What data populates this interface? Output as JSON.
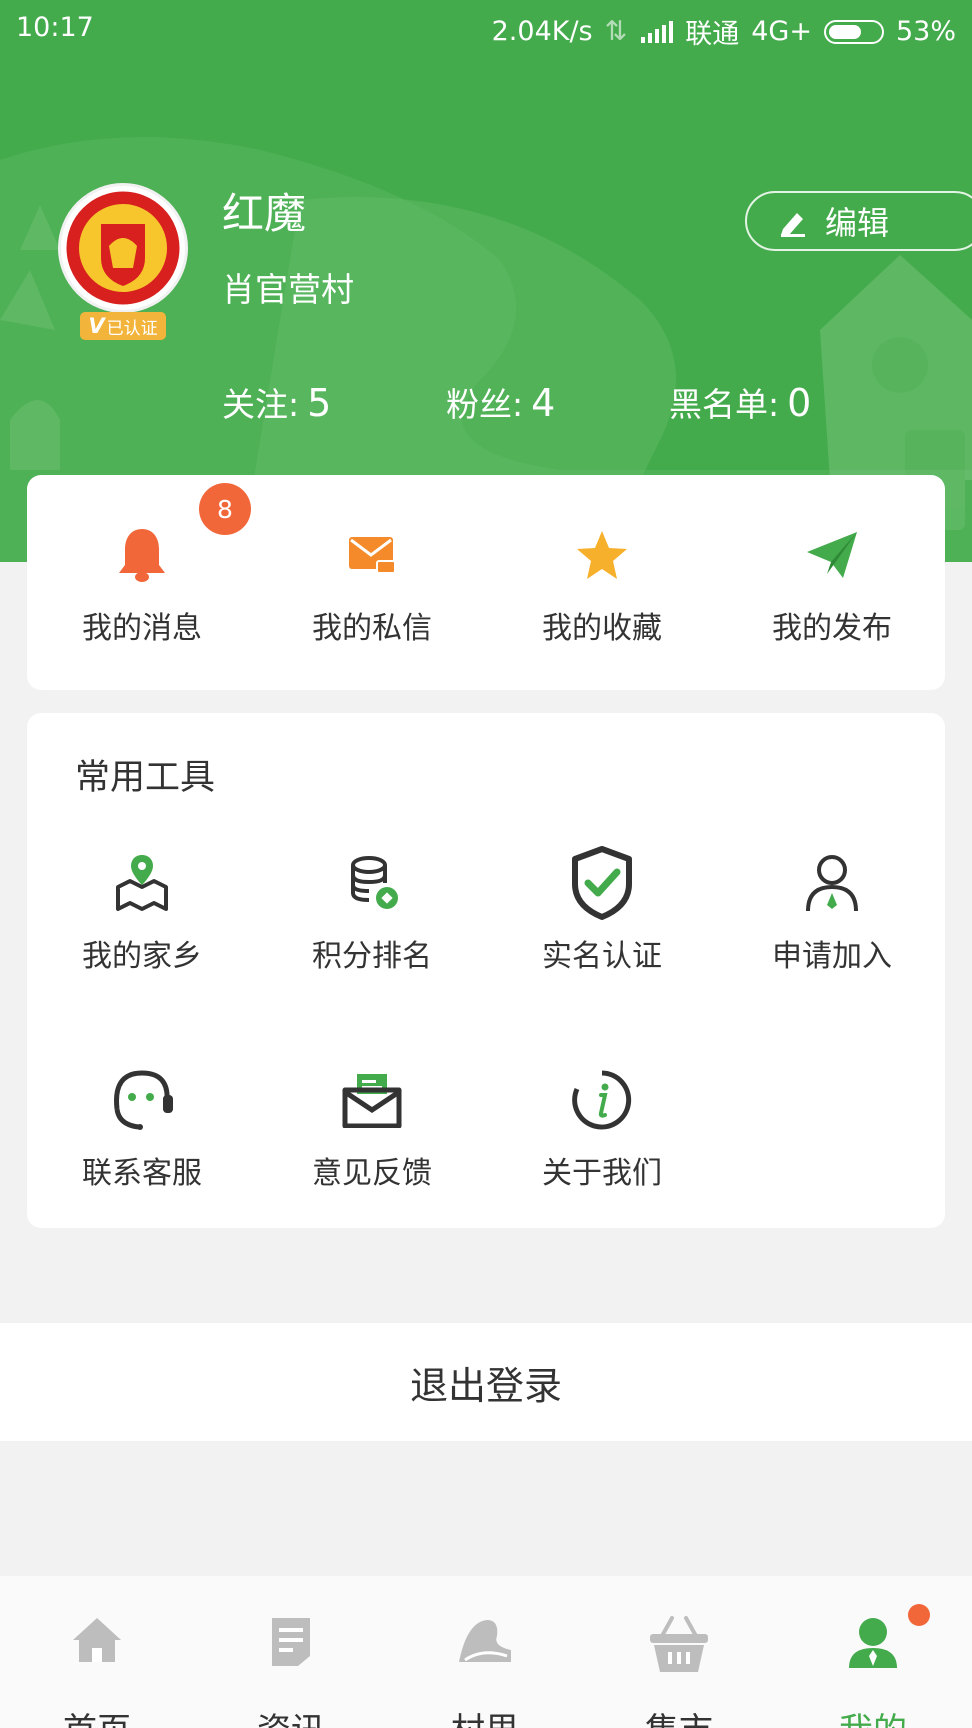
{
  "status_bar": {
    "time": "10:17",
    "speed": "2.04K/s",
    "carrier": "联通",
    "network": "4G+",
    "battery": "53%",
    "battery_level": 0.53
  },
  "profile": {
    "name": "红魔",
    "village": "肖官营村",
    "verified_label": "已认证",
    "verified_v": "V",
    "edit_label": "编辑"
  },
  "stats": [
    {
      "label": "关注:",
      "value": "5"
    },
    {
      "label": "粉丝:",
      "value": "4"
    },
    {
      "label": "黑名单:",
      "value": "0"
    }
  ],
  "quick_actions": [
    {
      "label": "我的消息",
      "icon": "bell-icon",
      "badge": "8"
    },
    {
      "label": "我的私信",
      "icon": "mail-icon"
    },
    {
      "label": "我的收藏",
      "icon": "star-icon"
    },
    {
      "label": "我的发布",
      "icon": "paper-plane-icon"
    }
  ],
  "tools": {
    "title": "常用工具",
    "items": [
      {
        "label": "我的家乡",
        "icon": "map-pin-icon"
      },
      {
        "label": "积分排名",
        "icon": "coins-icon"
      },
      {
        "label": "实名认证",
        "icon": "shield-check-icon"
      },
      {
        "label": "申请加入",
        "icon": "person-icon"
      },
      {
        "label": "联系客服",
        "icon": "headset-icon"
      },
      {
        "label": "意见反馈",
        "icon": "feedback-mail-icon"
      },
      {
        "label": "关于我们",
        "icon": "info-icon"
      }
    ]
  },
  "logout_label": "退出登录",
  "tabs": [
    {
      "label": "首页",
      "icon": "home-icon"
    },
    {
      "label": "资讯",
      "icon": "news-icon"
    },
    {
      "label": "村里",
      "icon": "village-icon"
    },
    {
      "label": "集市",
      "icon": "basket-icon"
    },
    {
      "label": "我的",
      "icon": "user-icon",
      "active": true
    }
  ],
  "colors": {
    "primary": "#44ab4c",
    "badge": "#f2673a",
    "bell": "#f2673a",
    "mail": "#f58a2a",
    "star": "#f6b02b",
    "plane": "#44ab4c",
    "tab_inactive": "#bdbdbd"
  }
}
